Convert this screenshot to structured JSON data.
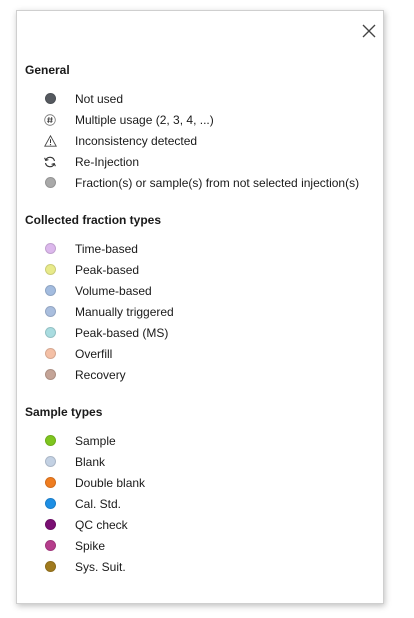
{
  "dialog": {
    "close_icon": "close-icon"
  },
  "general": {
    "title": "General",
    "items": [
      {
        "label": "Not used",
        "icon": "filled-circle",
        "color": "#55595f"
      },
      {
        "label": "Multiple usage (2, 3, 4, ...)",
        "icon": "hash-circle-icon"
      },
      {
        "label": "Inconsistency detected",
        "icon": "warning-triangle-icon"
      },
      {
        "label": "Re-Injection",
        "icon": "refresh-icon"
      },
      {
        "label": "Fraction(s) or sample(s)  from not selected injection(s)",
        "icon": "filled-circle",
        "color": "#a9a9a9"
      }
    ]
  },
  "fraction_types": {
    "title": "Collected fraction types",
    "items": [
      {
        "label": "Time-based",
        "color": "#dcb8ec"
      },
      {
        "label": "Peak-based",
        "color": "#e8ea8a"
      },
      {
        "label": "Volume-based",
        "color": "#a3bcdf"
      },
      {
        "label": "Manually triggered",
        "color": "#a9bede"
      },
      {
        "label": "Peak-based (MS)",
        "color": "#a9dce0"
      },
      {
        "label": "Overfill",
        "color": "#f4c0a6"
      },
      {
        "label": "Recovery",
        "color": "#c4a497"
      }
    ]
  },
  "sample_types": {
    "title": "Sample types",
    "items": [
      {
        "label": "Sample",
        "color": "#7ec51f"
      },
      {
        "label": "Blank",
        "color": "#c3d1e3"
      },
      {
        "label": "Double blank",
        "color": "#ef7d20"
      },
      {
        "label": "Cal. Std.",
        "color": "#1e8fe4"
      },
      {
        "label": "QC check",
        "color": "#7a0f73"
      },
      {
        "label": "Spike",
        "color": "#b63d8c"
      },
      {
        "label": "Sys. Suit.",
        "color": "#a07a1e"
      }
    ]
  }
}
